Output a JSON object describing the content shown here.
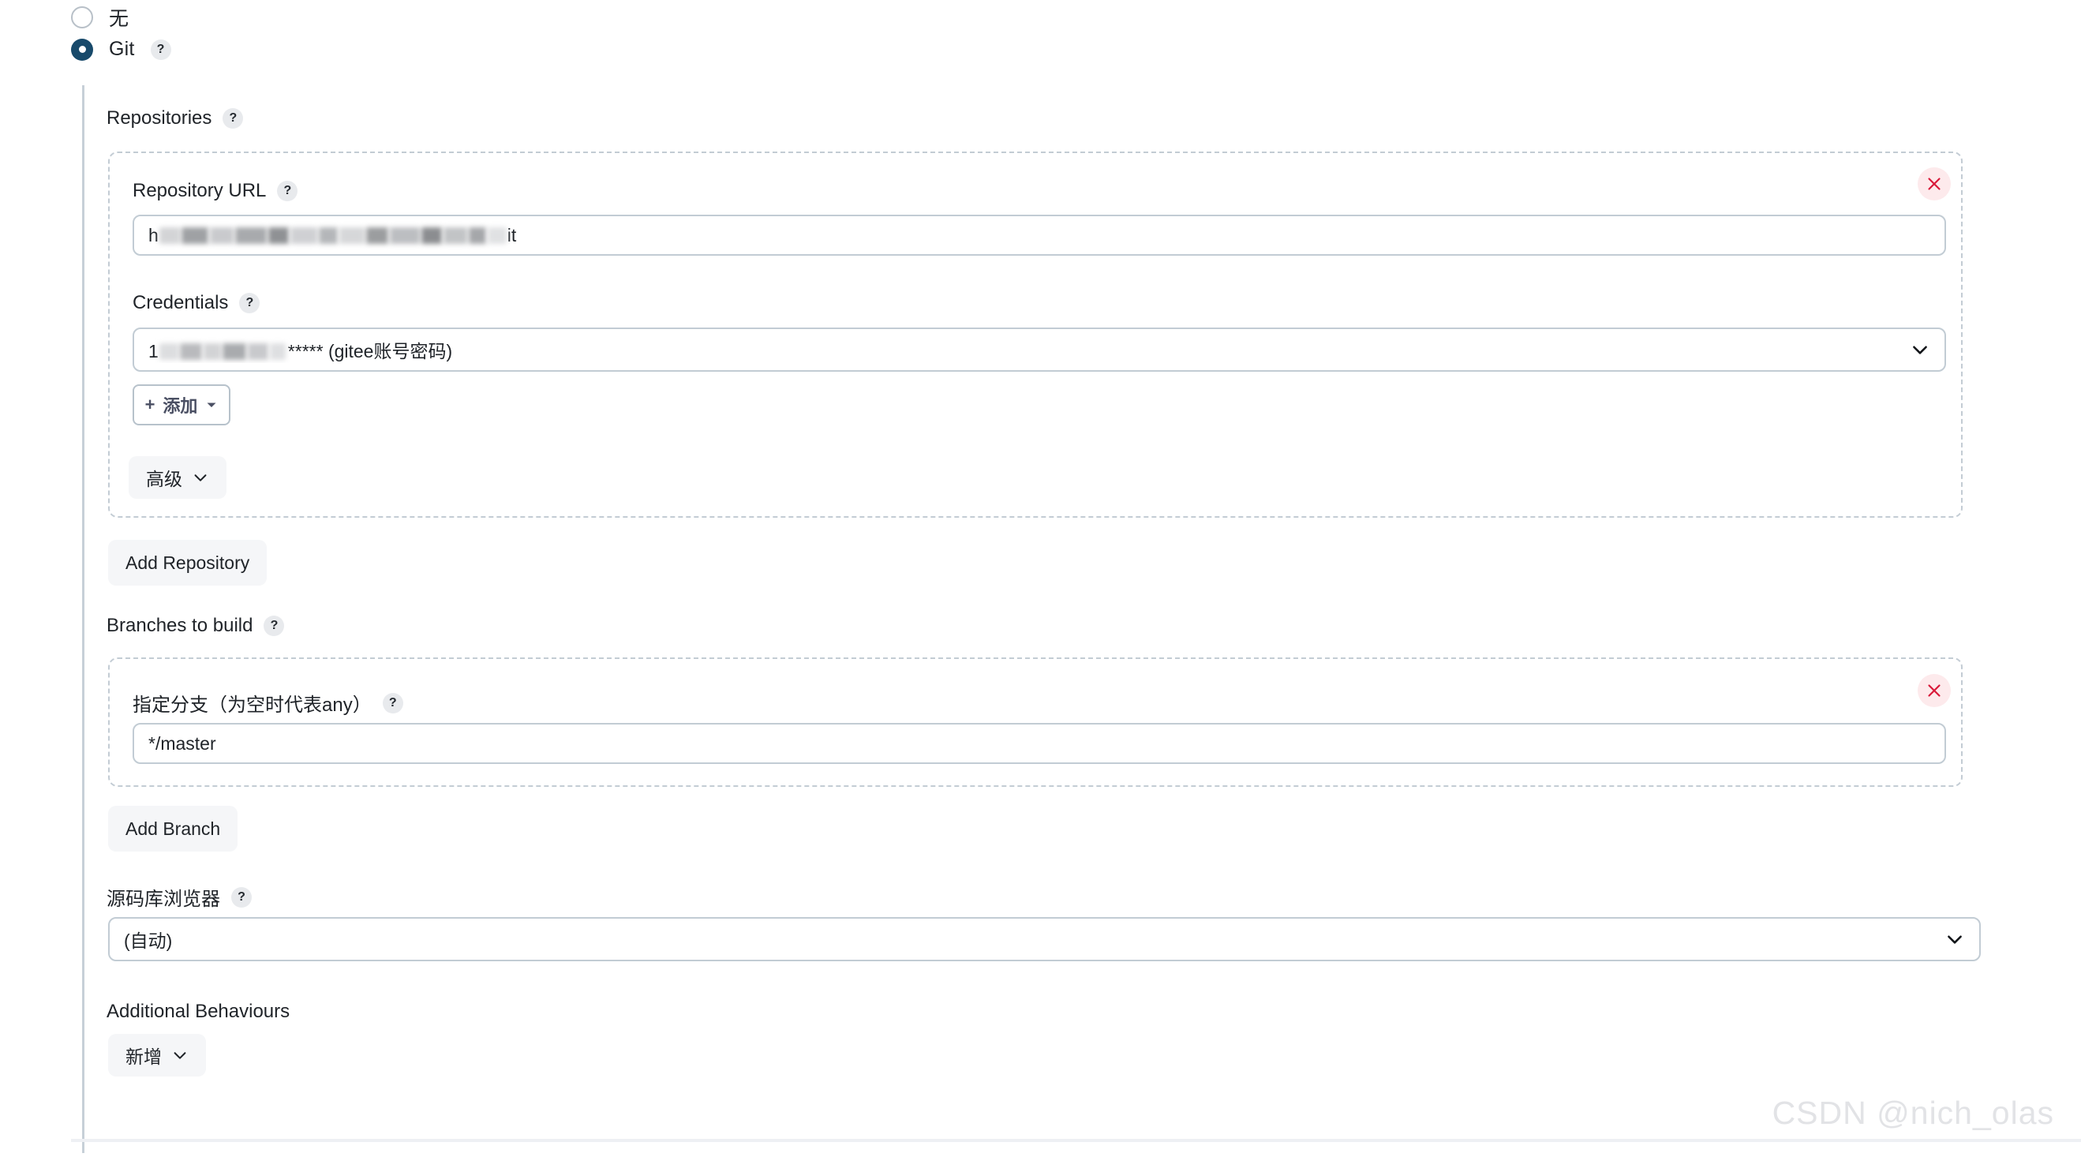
{
  "scm": {
    "options": [
      {
        "label": "无",
        "selected": false
      },
      {
        "label": "Git",
        "selected": true,
        "help": "?"
      }
    ]
  },
  "repositories": {
    "label": "Repositories",
    "help": "?",
    "repo": {
      "url_field": {
        "label": "Repository URL",
        "help": "?",
        "value_prefix": "h",
        "value_suffix": "it",
        "redacted": true
      },
      "credentials_field": {
        "label": "Credentials",
        "help": "?",
        "value_prefix": "1",
        "value_suffix": "*****  (gitee账号密码)",
        "redacted": true
      },
      "add_credentials_button": "添加",
      "add_credentials_plus": "+",
      "advanced_button": "高级"
    },
    "add_repository_button": "Add Repository",
    "remove_icon": "×"
  },
  "branches": {
    "label": "Branches to build",
    "help": "?",
    "branch": {
      "label": "指定分支（为空时代表any）",
      "help": "?",
      "value": "*/master"
    },
    "add_branch_button": "Add Branch",
    "remove_icon": "×"
  },
  "repository_browser": {
    "label": "源码库浏览器",
    "help": "?",
    "value": "(自动)"
  },
  "additional_behaviours": {
    "label": "Additional Behaviours",
    "add_button": "新增"
  },
  "watermark": "CSDN @nich_olas",
  "colors": {
    "radio_selected": "#184a6b",
    "remove_bg": "#fdeaec",
    "remove_fg": "#d91a3a",
    "dashed_border": "#c3ccd4",
    "input_border": "#c2ccd4",
    "button_bg": "#f5f6f8"
  }
}
